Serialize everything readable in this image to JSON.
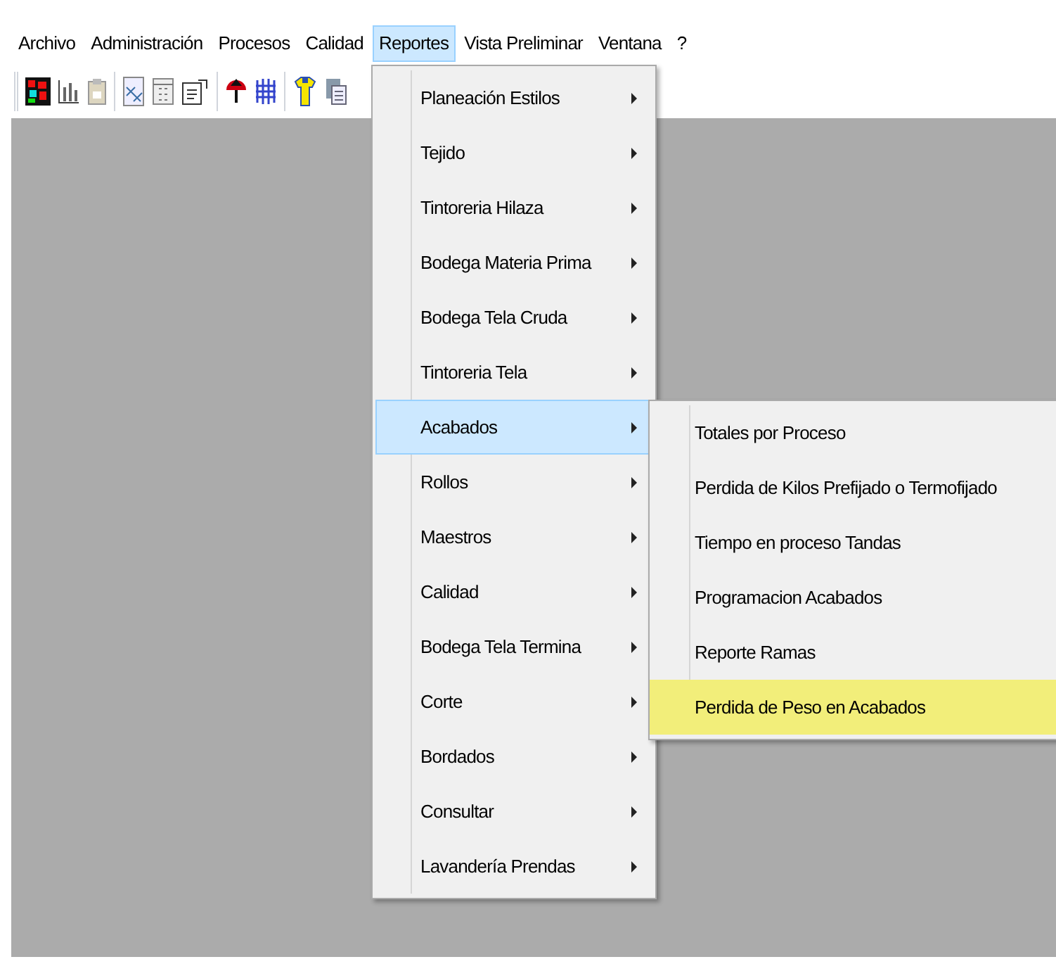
{
  "menu_bar": [
    {
      "label": "Archivo",
      "selected": false
    },
    {
      "label": "Administración",
      "selected": false
    },
    {
      "label": "Procesos",
      "selected": false
    },
    {
      "label": "Calidad",
      "selected": false
    },
    {
      "label": "Reportes",
      "selected": true
    },
    {
      "label": "Vista Preliminar",
      "selected": false
    },
    {
      "label": "Ventana",
      "selected": false
    },
    {
      "label": "?",
      "selected": false
    }
  ],
  "reports_menu": [
    {
      "label": "Planeación Estilos",
      "selected": false,
      "has_submenu": true
    },
    {
      "label": "Tejido",
      "selected": false,
      "has_submenu": true
    },
    {
      "label": "Tintoreria Hilaza",
      "selected": false,
      "has_submenu": true
    },
    {
      "label": "Bodega Materia Prima",
      "selected": false,
      "has_submenu": true
    },
    {
      "label": "Bodega Tela Cruda",
      "selected": false,
      "has_submenu": true
    },
    {
      "label": "Tintoreria Tela",
      "selected": false,
      "has_submenu": true
    },
    {
      "label": "Acabados",
      "selected": true,
      "has_submenu": true
    },
    {
      "label": "Rollos",
      "selected": false,
      "has_submenu": true
    },
    {
      "label": "Maestros",
      "selected": false,
      "has_submenu": true
    },
    {
      "label": "Calidad",
      "selected": false,
      "has_submenu": true
    },
    {
      "label": "Bodega Tela Termina",
      "selected": false,
      "has_submenu": true
    },
    {
      "label": "Corte",
      "selected": false,
      "has_submenu": true
    },
    {
      "label": "Bordados",
      "selected": false,
      "has_submenu": true
    },
    {
      "label": "Consultar",
      "selected": false,
      "has_submenu": true
    },
    {
      "label": "Lavandería Prendas",
      "selected": false,
      "has_submenu": true
    }
  ],
  "acabados_submenu": [
    {
      "label": "Totales por Proceso",
      "selected": false
    },
    {
      "label": "Perdida de Kilos Prefijado o Termofijado",
      "selected": false
    },
    {
      "label": "Tiempo en proceso Tandas",
      "selected": false
    },
    {
      "label": "Programacion Acabados",
      "selected": false
    },
    {
      "label": "Reporte Ramas",
      "selected": false
    },
    {
      "label": "Perdida de Peso en Acabados",
      "selected": true
    }
  ]
}
